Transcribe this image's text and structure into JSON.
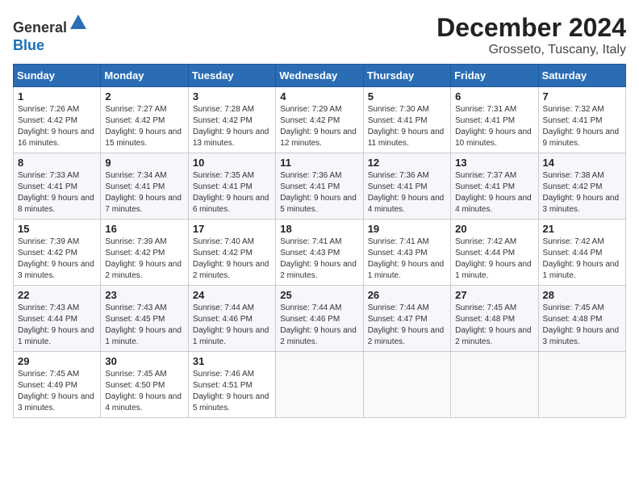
{
  "header": {
    "logo_line1": "General",
    "logo_line2": "Blue",
    "month_title": "December 2024",
    "location": "Grosseto, Tuscany, Italy"
  },
  "calendar": {
    "days_of_week": [
      "Sunday",
      "Monday",
      "Tuesday",
      "Wednesday",
      "Thursday",
      "Friday",
      "Saturday"
    ],
    "weeks": [
      [
        {
          "day": "1",
          "sunrise": "7:26 AM",
          "sunset": "4:42 PM",
          "daylight": "9 hours and 16 minutes."
        },
        {
          "day": "2",
          "sunrise": "7:27 AM",
          "sunset": "4:42 PM",
          "daylight": "9 hours and 15 minutes."
        },
        {
          "day": "3",
          "sunrise": "7:28 AM",
          "sunset": "4:42 PM",
          "daylight": "9 hours and 13 minutes."
        },
        {
          "day": "4",
          "sunrise": "7:29 AM",
          "sunset": "4:42 PM",
          "daylight": "9 hours and 12 minutes."
        },
        {
          "day": "5",
          "sunrise": "7:30 AM",
          "sunset": "4:41 PM",
          "daylight": "9 hours and 11 minutes."
        },
        {
          "day": "6",
          "sunrise": "7:31 AM",
          "sunset": "4:41 PM",
          "daylight": "9 hours and 10 minutes."
        },
        {
          "day": "7",
          "sunrise": "7:32 AM",
          "sunset": "4:41 PM",
          "daylight": "9 hours and 9 minutes."
        }
      ],
      [
        {
          "day": "8",
          "sunrise": "7:33 AM",
          "sunset": "4:41 PM",
          "daylight": "9 hours and 8 minutes."
        },
        {
          "day": "9",
          "sunrise": "7:34 AM",
          "sunset": "4:41 PM",
          "daylight": "9 hours and 7 minutes."
        },
        {
          "day": "10",
          "sunrise": "7:35 AM",
          "sunset": "4:41 PM",
          "daylight": "9 hours and 6 minutes."
        },
        {
          "day": "11",
          "sunrise": "7:36 AM",
          "sunset": "4:41 PM",
          "daylight": "9 hours and 5 minutes."
        },
        {
          "day": "12",
          "sunrise": "7:36 AM",
          "sunset": "4:41 PM",
          "daylight": "9 hours and 4 minutes."
        },
        {
          "day": "13",
          "sunrise": "7:37 AM",
          "sunset": "4:41 PM",
          "daylight": "9 hours and 4 minutes."
        },
        {
          "day": "14",
          "sunrise": "7:38 AM",
          "sunset": "4:42 PM",
          "daylight": "9 hours and 3 minutes."
        }
      ],
      [
        {
          "day": "15",
          "sunrise": "7:39 AM",
          "sunset": "4:42 PM",
          "daylight": "9 hours and 3 minutes."
        },
        {
          "day": "16",
          "sunrise": "7:39 AM",
          "sunset": "4:42 PM",
          "daylight": "9 hours and 2 minutes."
        },
        {
          "day": "17",
          "sunrise": "7:40 AM",
          "sunset": "4:42 PM",
          "daylight": "9 hours and 2 minutes."
        },
        {
          "day": "18",
          "sunrise": "7:41 AM",
          "sunset": "4:43 PM",
          "daylight": "9 hours and 2 minutes."
        },
        {
          "day": "19",
          "sunrise": "7:41 AM",
          "sunset": "4:43 PM",
          "daylight": "9 hours and 1 minute."
        },
        {
          "day": "20",
          "sunrise": "7:42 AM",
          "sunset": "4:44 PM",
          "daylight": "9 hours and 1 minute."
        },
        {
          "day": "21",
          "sunrise": "7:42 AM",
          "sunset": "4:44 PM",
          "daylight": "9 hours and 1 minute."
        }
      ],
      [
        {
          "day": "22",
          "sunrise": "7:43 AM",
          "sunset": "4:44 PM",
          "daylight": "9 hours and 1 minute."
        },
        {
          "day": "23",
          "sunrise": "7:43 AM",
          "sunset": "4:45 PM",
          "daylight": "9 hours and 1 minute."
        },
        {
          "day": "24",
          "sunrise": "7:44 AM",
          "sunset": "4:46 PM",
          "daylight": "9 hours and 1 minute."
        },
        {
          "day": "25",
          "sunrise": "7:44 AM",
          "sunset": "4:46 PM",
          "daylight": "9 hours and 2 minutes."
        },
        {
          "day": "26",
          "sunrise": "7:44 AM",
          "sunset": "4:47 PM",
          "daylight": "9 hours and 2 minutes."
        },
        {
          "day": "27",
          "sunrise": "7:45 AM",
          "sunset": "4:48 PM",
          "daylight": "9 hours and 2 minutes."
        },
        {
          "day": "28",
          "sunrise": "7:45 AM",
          "sunset": "4:48 PM",
          "daylight": "9 hours and 3 minutes."
        }
      ],
      [
        {
          "day": "29",
          "sunrise": "7:45 AM",
          "sunset": "4:49 PM",
          "daylight": "9 hours and 3 minutes."
        },
        {
          "day": "30",
          "sunrise": "7:45 AM",
          "sunset": "4:50 PM",
          "daylight": "9 hours and 4 minutes."
        },
        {
          "day": "31",
          "sunrise": "7:46 AM",
          "sunset": "4:51 PM",
          "daylight": "9 hours and 5 minutes."
        },
        null,
        null,
        null,
        null
      ]
    ]
  }
}
